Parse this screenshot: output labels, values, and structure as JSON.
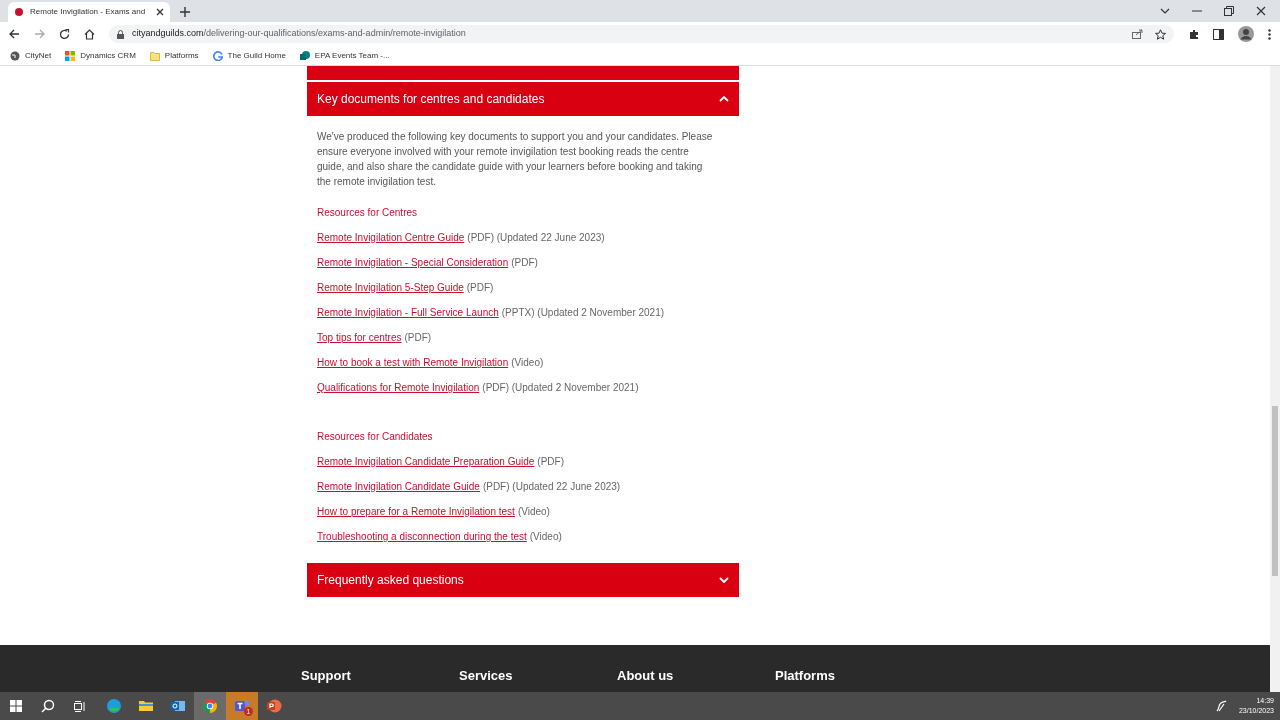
{
  "browser": {
    "tab": {
      "title": "Remote Invigilation - Exams and"
    },
    "url": {
      "domain": "cityandguilds.com",
      "path": "/delivering-our-qualifications/exams-and-admin/remote-invigilation"
    },
    "bookmarks": [
      {
        "label": "CityNet",
        "kind": "globe"
      },
      {
        "label": "Dynamics CRM",
        "kind": "tiles"
      },
      {
        "label": "Platforms",
        "kind": "folder"
      },
      {
        "label": "The Guild Home",
        "kind": "g"
      },
      {
        "label": "EPA Events Team -...",
        "kind": "sharepoint"
      }
    ]
  },
  "accordion": [
    {
      "title": "Key documents for centres and candidates",
      "expanded": true,
      "intro": "We've produced the following key documents to support you and your candidates. Please ensure everyone involved with your remote invigilation test booking reads the centre guide, and also share the candidate guide with your learners before booking and taking the remote invigilation test.",
      "groups": [
        {
          "heading": "Resources for Centres",
          "links": [
            {
              "link": "Remote Invigilation Centre Guide",
              "note": "(PDF) (Updated 22 June 2023)"
            },
            {
              "link": "Remote Invigilation - Special Consideration",
              "note": "(PDF)"
            },
            {
              "link": "Remote Invigilation 5-Step Guide",
              "note": "(PDF)"
            },
            {
              "link": "Remote Invigilation - Full Service Launch",
              "note": "(PPTX) (Updated 2 November 2021)"
            },
            {
              "link": "Top tips for centres",
              "note": "(PDF)"
            },
            {
              "link": "How to book a test with Remote Invigilation",
              "note": "(Video)"
            },
            {
              "link": "Qualifications for Remote Invigilation",
              "note": "(PDF) (Updated 2 November 2021)"
            }
          ]
        },
        {
          "heading": "Resources for Candidates",
          "links": [
            {
              "link": "Remote Invigilation Candidate Preparation Guide",
              "note": "(PDF)"
            },
            {
              "link": "Remote Invigilation Candidate Guide",
              "note": "(PDF) (Updated 22 June 2023)"
            },
            {
              "link": "How to prepare for a Remote Invigilation test",
              "note": "(Video)"
            },
            {
              "link": "Troubleshooting a disconnection during the test",
              "note": "(Video)"
            }
          ]
        }
      ]
    },
    {
      "title": "Frequently asked questions",
      "expanded": false
    }
  ],
  "footer": {
    "headings": [
      "Support",
      "Services",
      "About us",
      "Platforms"
    ]
  },
  "taskbar": {
    "apps": [
      {
        "kind": "edge"
      },
      {
        "kind": "explorer"
      },
      {
        "kind": "outlook"
      },
      {
        "kind": "chrome",
        "selected": true
      },
      {
        "kind": "teams",
        "badge": "1"
      },
      {
        "kind": "powerpoint"
      }
    ],
    "time": "14:39",
    "date": "23/10/2023"
  }
}
